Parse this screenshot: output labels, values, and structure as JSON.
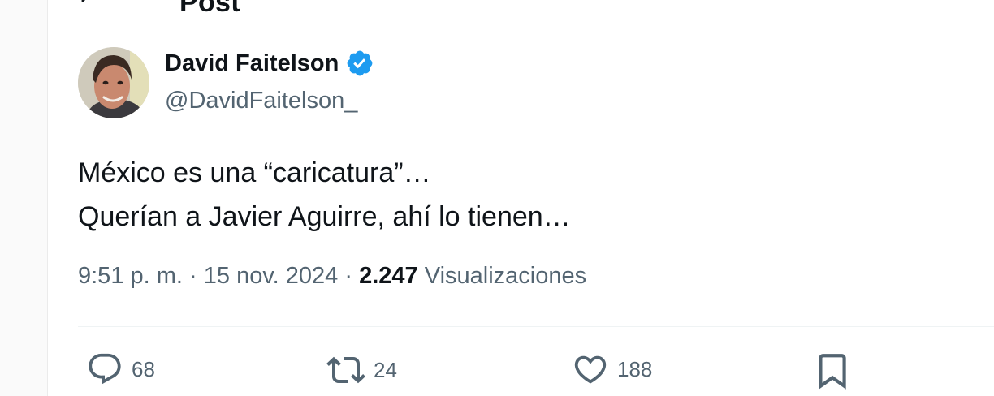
{
  "header": {
    "title": "Post"
  },
  "author": {
    "display_name": "David Faitelson",
    "handle": "@DavidFaitelson_",
    "verified": true
  },
  "tweet": {
    "lines": [
      "México es una “caricatura”…",
      "Querían a Javier Aguirre, ahí lo tienen…"
    ]
  },
  "meta": {
    "time": "9:51 p. m.",
    "separator": "·",
    "date": "15 nov. 2024",
    "views_count": "2.247",
    "views_label": "Visualizaciones"
  },
  "actions": {
    "replies": "68",
    "reposts": "24",
    "likes": "188"
  },
  "colors": {
    "text_primary": "#0f1419",
    "text_secondary": "#536471",
    "verified_blue": "#1d9bf0",
    "divider": "#eff3f4"
  },
  "icons": [
    "back-arrow-icon",
    "verified-badge-icon",
    "reply-icon",
    "repost-icon",
    "like-icon",
    "bookmark-icon"
  ]
}
